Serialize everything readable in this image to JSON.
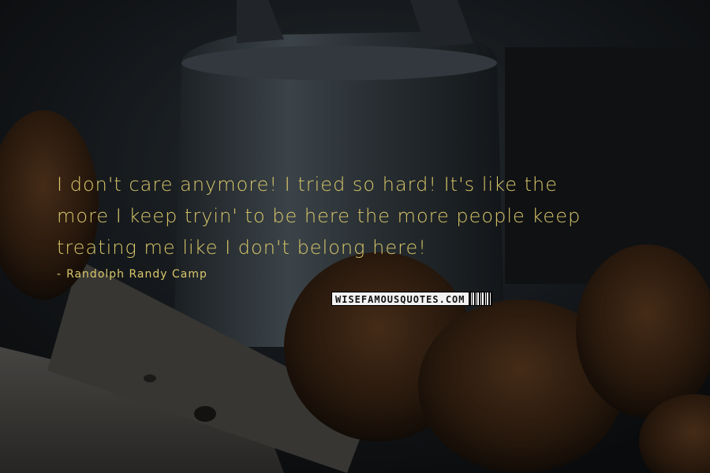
{
  "quote": {
    "line1": "I don't care anymore! I tried so hard! It's like the",
    "line2": "more I keep tryin' to be here the more people keep",
    "line3": "treating me like I don't belong here!"
  },
  "author": {
    "dash": "-",
    "name": "Randolph Randy Camp"
  },
  "watermark": {
    "text": "WISEFAMOUSQUOTES.COM"
  },
  "colors": {
    "text": "#d9c76a",
    "background": "#1a1d20"
  }
}
